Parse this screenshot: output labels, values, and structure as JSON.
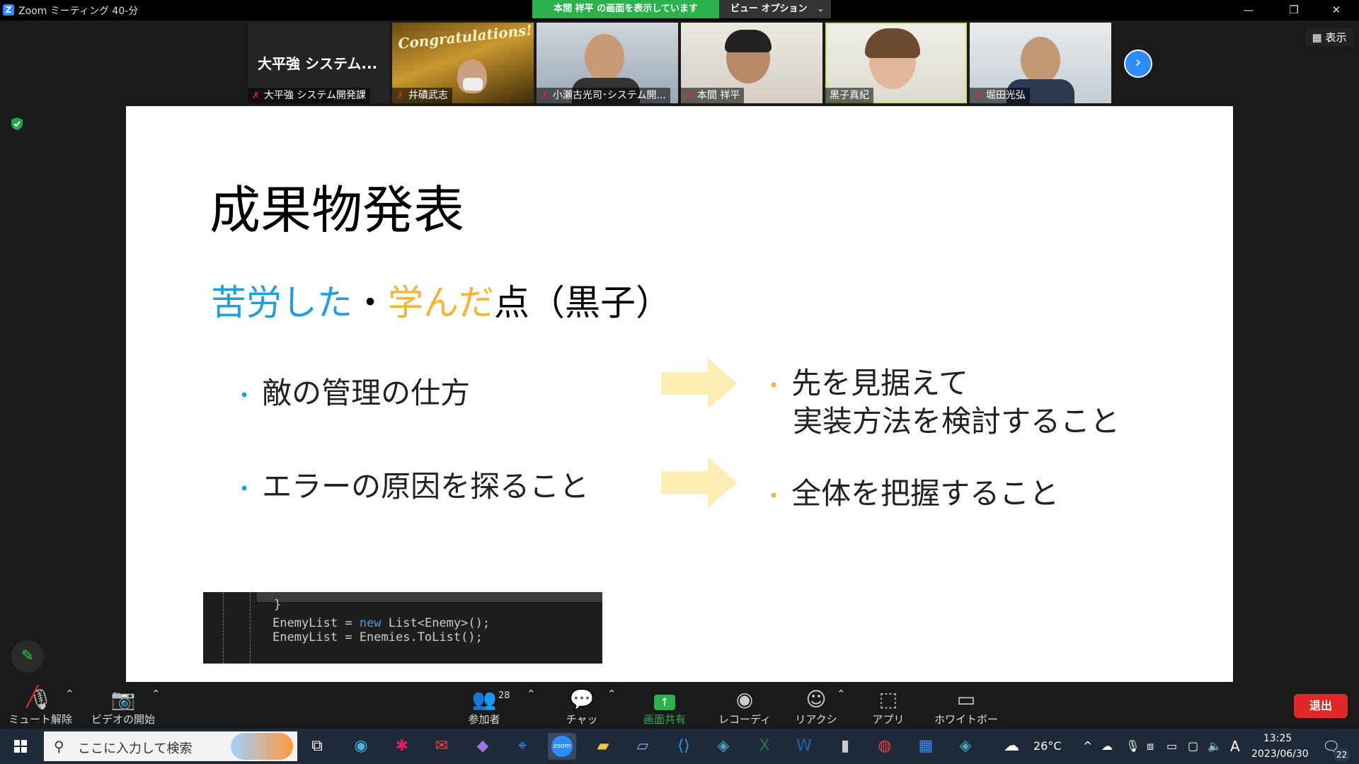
{
  "window": {
    "title": "Zoom ミーティング 40-分",
    "share_banner": "本間 祥平 の画面を表示しています",
    "view_options": "ビュー オプション",
    "minimize": "—",
    "restore": "❐",
    "close": "✕"
  },
  "gallery": {
    "view_toggle": "表示",
    "tiles": [
      {
        "big": "大平強 システム...",
        "name": "大平強 システム開発課"
      },
      {
        "name": "井磧武志",
        "banner": "Congratulations!"
      },
      {
        "name": "小瀬古光司･システム開..."
      },
      {
        "name": "本間 祥平"
      },
      {
        "name": "黒子真紀"
      },
      {
        "name": "堀田光弘"
      }
    ]
  },
  "slide": {
    "title": "成果物発表",
    "subtitle": {
      "part1": "苦労した",
      "sep": "・",
      "part2": "学んだ",
      "part3": "点（黒子）"
    },
    "left_bullets": [
      "敵の管理の仕方",
      "エラーの原因を探ること"
    ],
    "right_bullets": [
      {
        "line1": "先を見据えて",
        "line2": "実装方法を検討すること"
      },
      {
        "line1": "全体を把握すること"
      }
    ],
    "code": {
      "brace": "}",
      "line1_a": "EnemyList = ",
      "line1_kw": "new",
      "line1_b": " List<Enemy>();",
      "line2": "EnemyList = Enemies.ToList();"
    }
  },
  "toolbar": {
    "mute": "ミュート解除",
    "video": "ビデオの開始",
    "participants": "参加者",
    "participants_count": "28",
    "chat": "チャット",
    "share": "画面共有",
    "record": "レコーディング",
    "reactions": "リアクション",
    "apps": "アプリ",
    "whiteboard": "ホワイトボード",
    "exit": "退出"
  },
  "taskbar": {
    "search_placeholder": "ここに入力して検索",
    "weather": "26°C",
    "ime": "A",
    "time": "13:25",
    "date": "2023/06/30",
    "notifications": "22"
  },
  "colors": {
    "accent_blue": "#1ea0e0",
    "accent_orange": "#f5b533",
    "share_green": "#2bb24c",
    "exit_red": "#e02828",
    "zoom_blue": "#2d8cff"
  }
}
